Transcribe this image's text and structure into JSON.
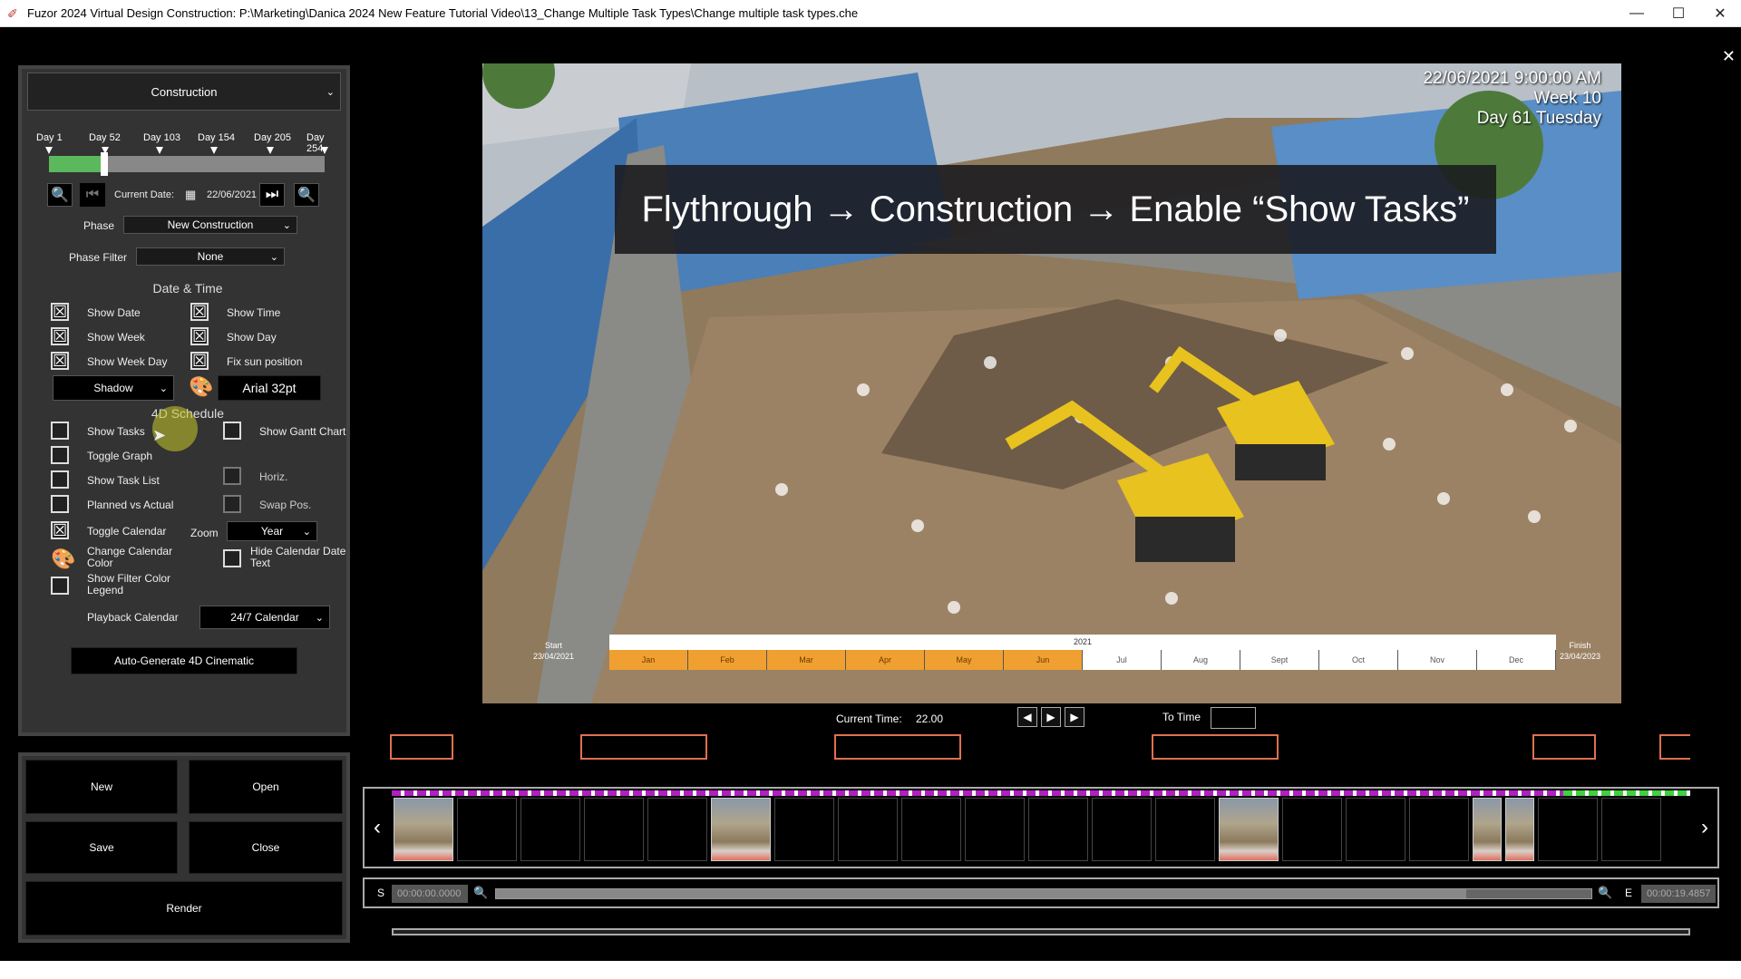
{
  "window": {
    "title": "Fuzor 2024 Virtual Design Construction: P:\\Marketing\\Danica 2024 New Feature Tutorial Video\\13_Change Multiple Task Types\\Change multiple task types.che",
    "min": "—",
    "max": "☐",
    "close": "✕"
  },
  "panel_close": "✕",
  "mode_select": {
    "value": "Construction"
  },
  "day_labels": [
    "Day 1",
    "Day 52",
    "Day 103",
    "Day 154",
    "Day 205",
    "Day 254"
  ],
  "slider": {
    "current_day_fraction": 0.2
  },
  "date_row": {
    "label": "Current Date:",
    "value": "22/06/2021"
  },
  "phase": {
    "label": "Phase",
    "value": "New Construction"
  },
  "phase_filter": {
    "label": "Phase Filter",
    "value": "None"
  },
  "date_time": {
    "heading": "Date & Time",
    "show_date": {
      "label": "Show Date",
      "checked": "☒"
    },
    "show_time": {
      "label": "Show Time",
      "checked": "☒"
    },
    "show_week": {
      "label": "Show Week",
      "checked": "☒"
    },
    "show_day": {
      "label": "Show Day",
      "checked": "☒"
    },
    "show_week_day": {
      "label": "Show Week Day",
      "checked": "☒"
    },
    "fix_sun": {
      "label": "Fix sun position",
      "checked": "☒"
    },
    "style_select": "Shadow",
    "font_button": "Arial 32pt"
  },
  "schedule": {
    "heading": "4D Schedule",
    "show_tasks": "Show Tasks",
    "show_gantt": "Show Gantt Chart",
    "toggle_graph": "Toggle Graph",
    "show_task_list": "Show Task List",
    "horiz": "Horiz.",
    "planned_vs_actual": "Planned vs Actual",
    "swap_pos": "Swap Pos.",
    "toggle_calendar": "Toggle Calendar",
    "zoom_label": "Zoom",
    "zoom_value": "Year",
    "change_calendar_color": "Change Calendar Color",
    "hide_calendar_date_text": "Hide Calendar Date Text",
    "show_filter_color_legend": "Show Filter Color Legend",
    "playback_label": "Playback Calendar",
    "playback_value": "24/7 Calendar",
    "auto_generate": "Auto-Generate 4D Cinematic"
  },
  "file_buttons": {
    "new": "New",
    "open": "Open",
    "save": "Save",
    "close": "Close",
    "render": "Render"
  },
  "viewport": {
    "date_line": "22/06/2021 9:00:00 AM",
    "week_line": "Week 10",
    "day_line": "Day 61 Tuesday",
    "banner": "Flythrough → Construction → Enable “Show Tasks”",
    "timeline": {
      "start_label": "Start",
      "start_date": "23/04/2021",
      "finish_label": "Finish",
      "finish_date": "23/04/2023",
      "year": "2021",
      "months": [
        "Jan",
        "Feb",
        "Mar",
        "Apr",
        "May",
        "Jun",
        "Jul",
        "Aug",
        "Sept",
        "Oct",
        "Nov",
        "Dec"
      ],
      "completed_months": 6
    }
  },
  "playback": {
    "current_time_label": "Current Time:",
    "current_time_value": "22.00",
    "to_time_label": "To Time",
    "prev": "◀",
    "play": "▶",
    "next": "▶"
  },
  "scrubber": {
    "start_label": "S",
    "start_time": "00:00:00.0000",
    "end_label": "E",
    "end_time": "00:00:19.4857"
  },
  "colors": {
    "accent_keyframe": "#e07050",
    "progress_purple": "#b020c0",
    "progress_green": "#40d040",
    "completed_month": "#f0a030"
  }
}
